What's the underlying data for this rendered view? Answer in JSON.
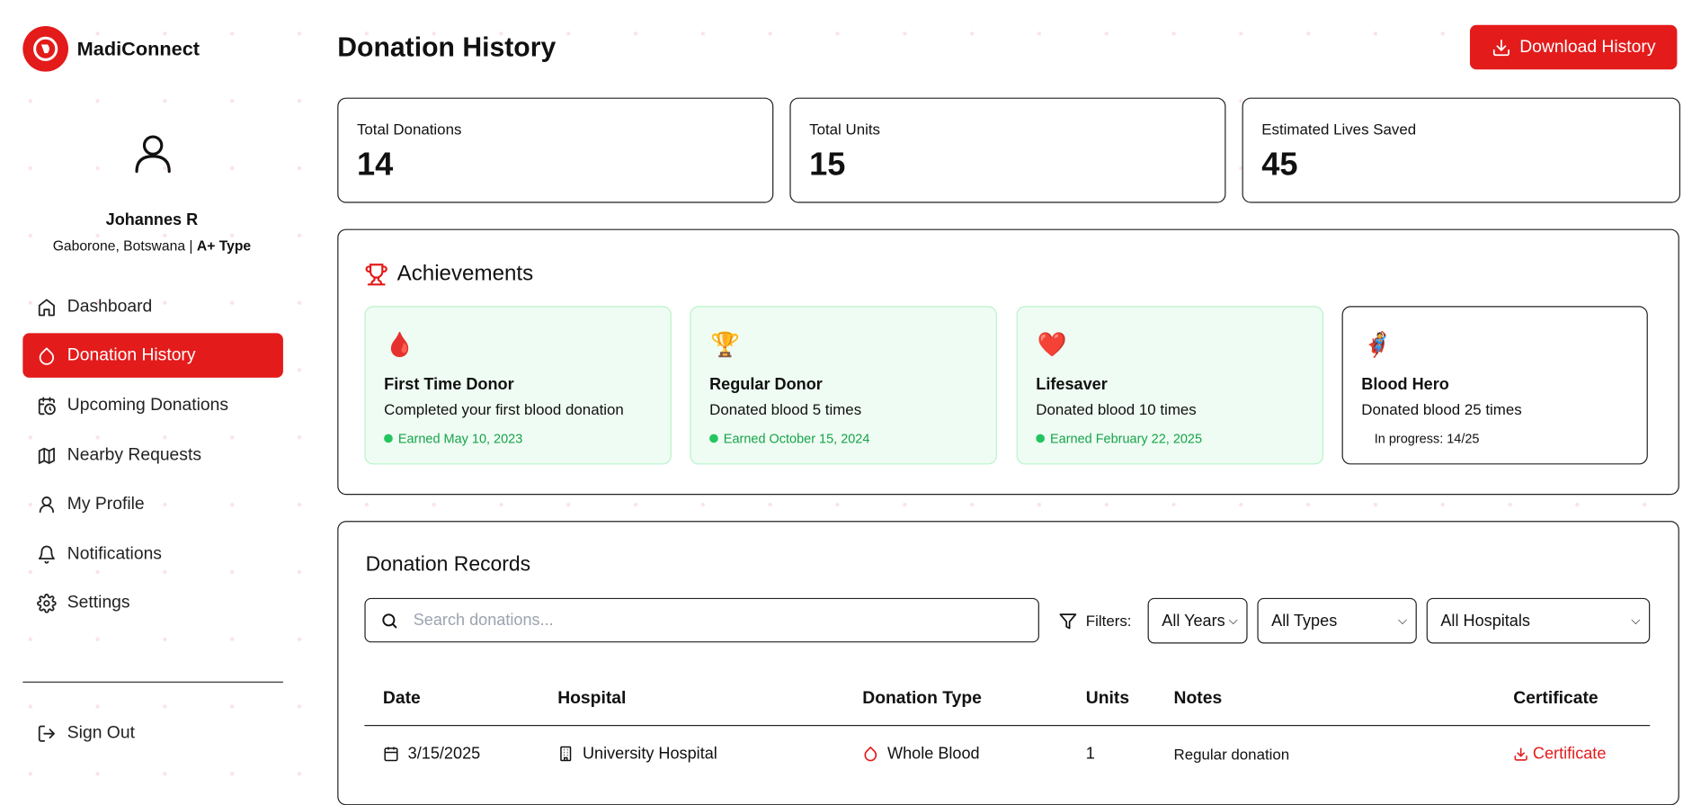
{
  "app": {
    "brand": "MadiConnect"
  },
  "user": {
    "name": "Johannes R",
    "location": "Gaborone, Botswana | ",
    "blood_type": "A+ Type"
  },
  "nav": [
    {
      "label": "Dashboard",
      "icon": "home-icon"
    },
    {
      "label": "Donation History",
      "icon": "droplet-icon",
      "active": true
    },
    {
      "label": "Upcoming Donations",
      "icon": "calendar-clock-icon"
    },
    {
      "label": "Nearby Requests",
      "icon": "map-icon"
    },
    {
      "label": "My Profile",
      "icon": "user-icon"
    },
    {
      "label": "Notifications",
      "icon": "bell-icon"
    },
    {
      "label": "Settings",
      "icon": "gear-icon"
    }
  ],
  "sign_out": "Sign Out",
  "header": {
    "title": "Donation History",
    "download_label": "Download History"
  },
  "stats": [
    {
      "label": "Total Donations",
      "value": "14"
    },
    {
      "label": "Total Units",
      "value": "15"
    },
    {
      "label": "Estimated Lives Saved",
      "value": "45"
    }
  ],
  "achievements": {
    "title": "Achievements",
    "items": [
      {
        "emoji": "🩸",
        "title": "First Time Donor",
        "desc": "Completed your first blood donation",
        "status": "Earned May 10, 2023"
      },
      {
        "emoji": "🏆",
        "title": "Regular Donor",
        "desc": "Donated blood 5 times",
        "status": "Earned October 15, 2024"
      },
      {
        "emoji": "❤️",
        "title": "Lifesaver",
        "desc": "Donated blood 10 times",
        "status": "Earned February 22, 2025"
      },
      {
        "emoji": "🦸",
        "title": "Blood Hero",
        "desc": "Donated blood 25 times",
        "status": "In progress: 14/25"
      }
    ]
  },
  "records": {
    "title": "Donation Records",
    "search_placeholder": "Search donations...",
    "filters_label": "Filters:",
    "filters": {
      "year": "All Years",
      "type": "All Types",
      "hospital": "All Hospitals"
    },
    "columns": [
      "Date",
      "Hospital",
      "Donation Type",
      "Units",
      "Notes",
      "Certificate"
    ],
    "rows": [
      {
        "date": "3/15/2025",
        "hospital": "University Hospital",
        "type": "Whole Blood",
        "units": "1",
        "notes": "Regular donation",
        "certificate": "Certificate"
      }
    ]
  },
  "colors": {
    "accent": "#e31b1b",
    "success": "#16a34a"
  }
}
